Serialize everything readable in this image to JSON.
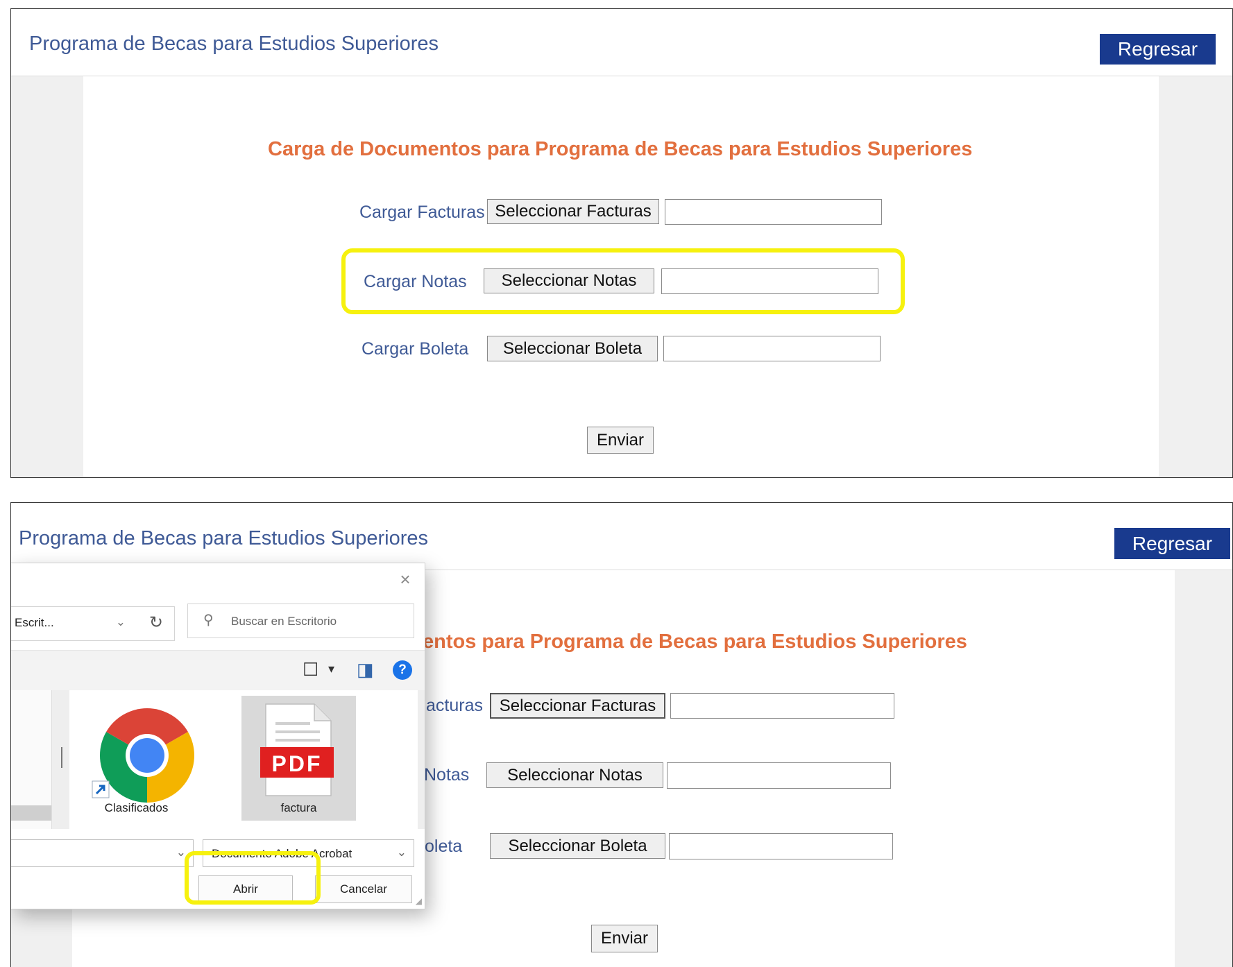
{
  "header": {
    "title": "Programa de Becas para Estudios Superiores",
    "back_label": "Regresar"
  },
  "form": {
    "title": "Carga de Documentos para Programa de Becas para Estudios Superiores",
    "rows": [
      {
        "label": "Cargar Facturas",
        "button": "Seleccionar Facturas",
        "value": ""
      },
      {
        "label": "Cargar Notas",
        "button": "Seleccionar Notas",
        "value": ""
      },
      {
        "label": "Cargar Boleta",
        "button": "Seleccionar Boleta",
        "value": ""
      }
    ],
    "submit_label": "Enviar"
  },
  "form_partial": {
    "title": "entos para Programa de Becas para Estudios Superiores",
    "row_labels": [
      "acturas",
      "Notas",
      "oleta"
    ]
  },
  "dialog": {
    "close_glyph": "×",
    "path": "Escrit...",
    "search_placeholder": "Buscar en Escritorio",
    "files": [
      {
        "name": "Clasificados",
        "icon": "chrome-shortcut-icon"
      },
      {
        "name": "factura",
        "icon": "pdf-file-icon"
      }
    ],
    "pdf_badge": "PDF",
    "file_type": "Documento Adobe Acrobat",
    "open_label": "Abrir",
    "cancel_label": "Cancelar"
  },
  "colors": {
    "header_text": "#3f5a96",
    "back_button": "#193a8e",
    "form_title": "#e26f3e",
    "highlight": "#f6f10e"
  }
}
